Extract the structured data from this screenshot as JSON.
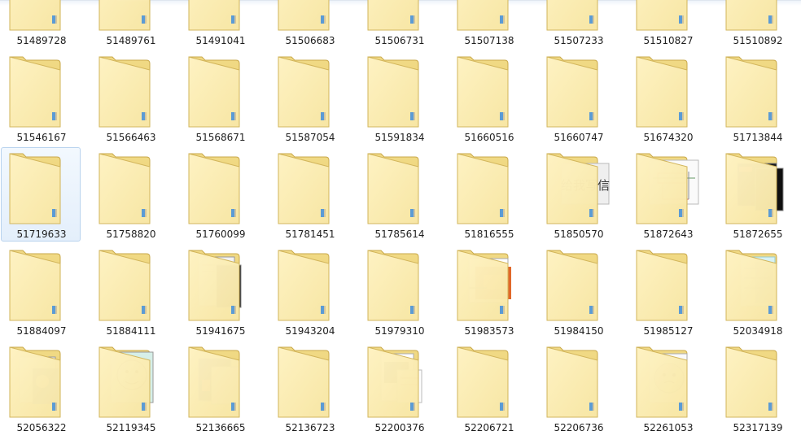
{
  "window": {
    "view_mode": "Large icons",
    "selected_item": "51719633"
  },
  "colors": {
    "folder_back": "#e9cf6f",
    "folder_front": "#f8e7a6",
    "selection_fill": "#e4effb",
    "selection_border": "#b9d3ee",
    "label_text": "#1e1e1e"
  },
  "grid": {
    "columns": 9,
    "items": [
      {
        "name": "51489728",
        "thumb": "none"
      },
      {
        "name": "51489761",
        "thumb": "doc"
      },
      {
        "name": "51491041",
        "thumb": "none"
      },
      {
        "name": "51506683",
        "thumb": "none"
      },
      {
        "name": "51506731",
        "thumb": "none"
      },
      {
        "name": "51507138",
        "thumb": "none"
      },
      {
        "name": "51507233",
        "thumb": "none"
      },
      {
        "name": "51510827",
        "thumb": "none"
      },
      {
        "name": "51510892",
        "thumb": "none"
      },
      {
        "name": "51546167",
        "thumb": "none"
      },
      {
        "name": "51566463",
        "thumb": "none"
      },
      {
        "name": "51568671",
        "thumb": "none"
      },
      {
        "name": "51587054",
        "thumb": "none"
      },
      {
        "name": "51591834",
        "thumb": "none"
      },
      {
        "name": "51660516",
        "thumb": "none"
      },
      {
        "name": "51660747",
        "thumb": "none"
      },
      {
        "name": "51674320",
        "thumb": "none"
      },
      {
        "name": "51713844",
        "thumb": "none"
      },
      {
        "name": "51719633",
        "thumb": "none"
      },
      {
        "name": "51758820",
        "thumb": "none"
      },
      {
        "name": "51760099",
        "thumb": "none"
      },
      {
        "name": "51781451",
        "thumb": "none"
      },
      {
        "name": "51785614",
        "thumb": "none"
      },
      {
        "name": "51816555",
        "thumb": "none"
      },
      {
        "name": "51850570",
        "thumb": "chinese",
        "thumb_text": "给我写信"
      },
      {
        "name": "51872643",
        "thumb": "diagram"
      },
      {
        "name": "51872655",
        "thumb": "dark"
      },
      {
        "name": "51884097",
        "thumb": "none"
      },
      {
        "name": "51884111",
        "thumb": "none"
      },
      {
        "name": "51941675",
        "thumb": "screen"
      },
      {
        "name": "51943204",
        "thumb": "none"
      },
      {
        "name": "51979310",
        "thumb": "none"
      },
      {
        "name": "51983573",
        "thumb": "orange"
      },
      {
        "name": "51984150",
        "thumb": "none"
      },
      {
        "name": "51985127",
        "thumb": "none"
      },
      {
        "name": "52034918",
        "thumb": "cyan"
      },
      {
        "name": "52056322",
        "thumb": "cartoon"
      },
      {
        "name": "52119345",
        "thumb": "meme"
      },
      {
        "name": "52136665",
        "thumb": "photo"
      },
      {
        "name": "52136723",
        "thumb": "none"
      },
      {
        "name": "52200376",
        "thumb": "webpage"
      },
      {
        "name": "52206721",
        "thumb": "none"
      },
      {
        "name": "52206736",
        "thumb": "none"
      },
      {
        "name": "52261053",
        "thumb": "face"
      },
      {
        "name": "52317139",
        "thumb": "none"
      }
    ]
  }
}
